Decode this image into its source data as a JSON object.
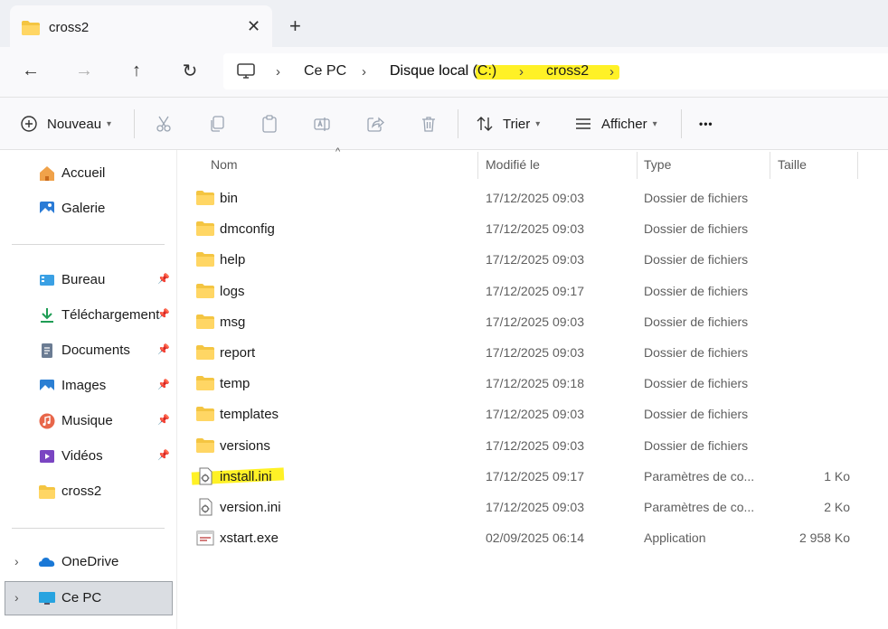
{
  "tab": {
    "title": "cross2",
    "close": "✕",
    "new_tab": "+"
  },
  "nav": {
    "back": "←",
    "forward": "→",
    "up": "↑",
    "refresh": "↻"
  },
  "breadcrumb": {
    "items": [
      "Ce PC",
      "Disque local (C:)",
      "cross2"
    ],
    "separator": "›"
  },
  "toolbar": {
    "new_label": "Nouveau",
    "sort_label": "Trier",
    "view_label": "Afficher",
    "more_label": "•••"
  },
  "sidebar": {
    "pin": "📌",
    "expander": "›",
    "top": [
      {
        "label": "Accueil",
        "icon": "home-icon"
      },
      {
        "label": "Galerie",
        "icon": "gallery-icon"
      }
    ],
    "pinned": [
      {
        "label": "Bureau",
        "icon": "desktop-icon"
      },
      {
        "label": "Téléchargement",
        "icon": "download-icon"
      },
      {
        "label": "Documents",
        "icon": "documents-icon"
      },
      {
        "label": "Images",
        "icon": "images-icon"
      },
      {
        "label": "Musique",
        "icon": "music-icon"
      },
      {
        "label": "Vidéos",
        "icon": "videos-icon"
      },
      {
        "label": "cross2",
        "icon": "folder-icon"
      }
    ],
    "drives": [
      {
        "label": "OneDrive",
        "icon": "onedrive-icon"
      },
      {
        "label": "Ce PC",
        "icon": "computer-icon",
        "selected": true
      }
    ]
  },
  "columns": {
    "name": "Nom",
    "modified": "Modifié le",
    "type": "Type",
    "size": "Taille",
    "sort_indicator": "^"
  },
  "files": [
    {
      "name": "bin",
      "modified": "17/12/2025 09:03",
      "type": "Dossier de fichiers",
      "size": "",
      "icon": "folder-icon"
    },
    {
      "name": "dmconfig",
      "modified": "17/12/2025 09:03",
      "type": "Dossier de fichiers",
      "size": "",
      "icon": "folder-icon"
    },
    {
      "name": "help",
      "modified": "17/12/2025 09:03",
      "type": "Dossier de fichiers",
      "size": "",
      "icon": "folder-icon"
    },
    {
      "name": "logs",
      "modified": "17/12/2025 09:17",
      "type": "Dossier de fichiers",
      "size": "",
      "icon": "folder-icon"
    },
    {
      "name": "msg",
      "modified": "17/12/2025 09:03",
      "type": "Dossier de fichiers",
      "size": "",
      "icon": "folder-icon"
    },
    {
      "name": "report",
      "modified": "17/12/2025 09:03",
      "type": "Dossier de fichiers",
      "size": "",
      "icon": "folder-icon"
    },
    {
      "name": "temp",
      "modified": "17/12/2025 09:18",
      "type": "Dossier de fichiers",
      "size": "",
      "icon": "folder-icon"
    },
    {
      "name": "templates",
      "modified": "17/12/2025 09:03",
      "type": "Dossier de fichiers",
      "size": "",
      "icon": "folder-icon"
    },
    {
      "name": "versions",
      "modified": "17/12/2025 09:03",
      "type": "Dossier de fichiers",
      "size": "",
      "icon": "folder-icon"
    },
    {
      "name": "install.ini",
      "modified": "17/12/2025 09:17",
      "type": "Paramètres de co...",
      "size": "1 Ko",
      "icon": "settings-file-icon"
    },
    {
      "name": "version.ini",
      "modified": "17/12/2025 09:03",
      "type": "Paramètres de co...",
      "size": "2 Ko",
      "icon": "settings-file-icon"
    },
    {
      "name": "xstart.exe",
      "modified": "02/09/2025 06:14",
      "type": "Application",
      "size": "2 958 Ko",
      "icon": "application-icon"
    }
  ],
  "colors": {
    "folder": "#f4c542",
    "highlight": "#ffee00",
    "accent": "#0067c0"
  }
}
